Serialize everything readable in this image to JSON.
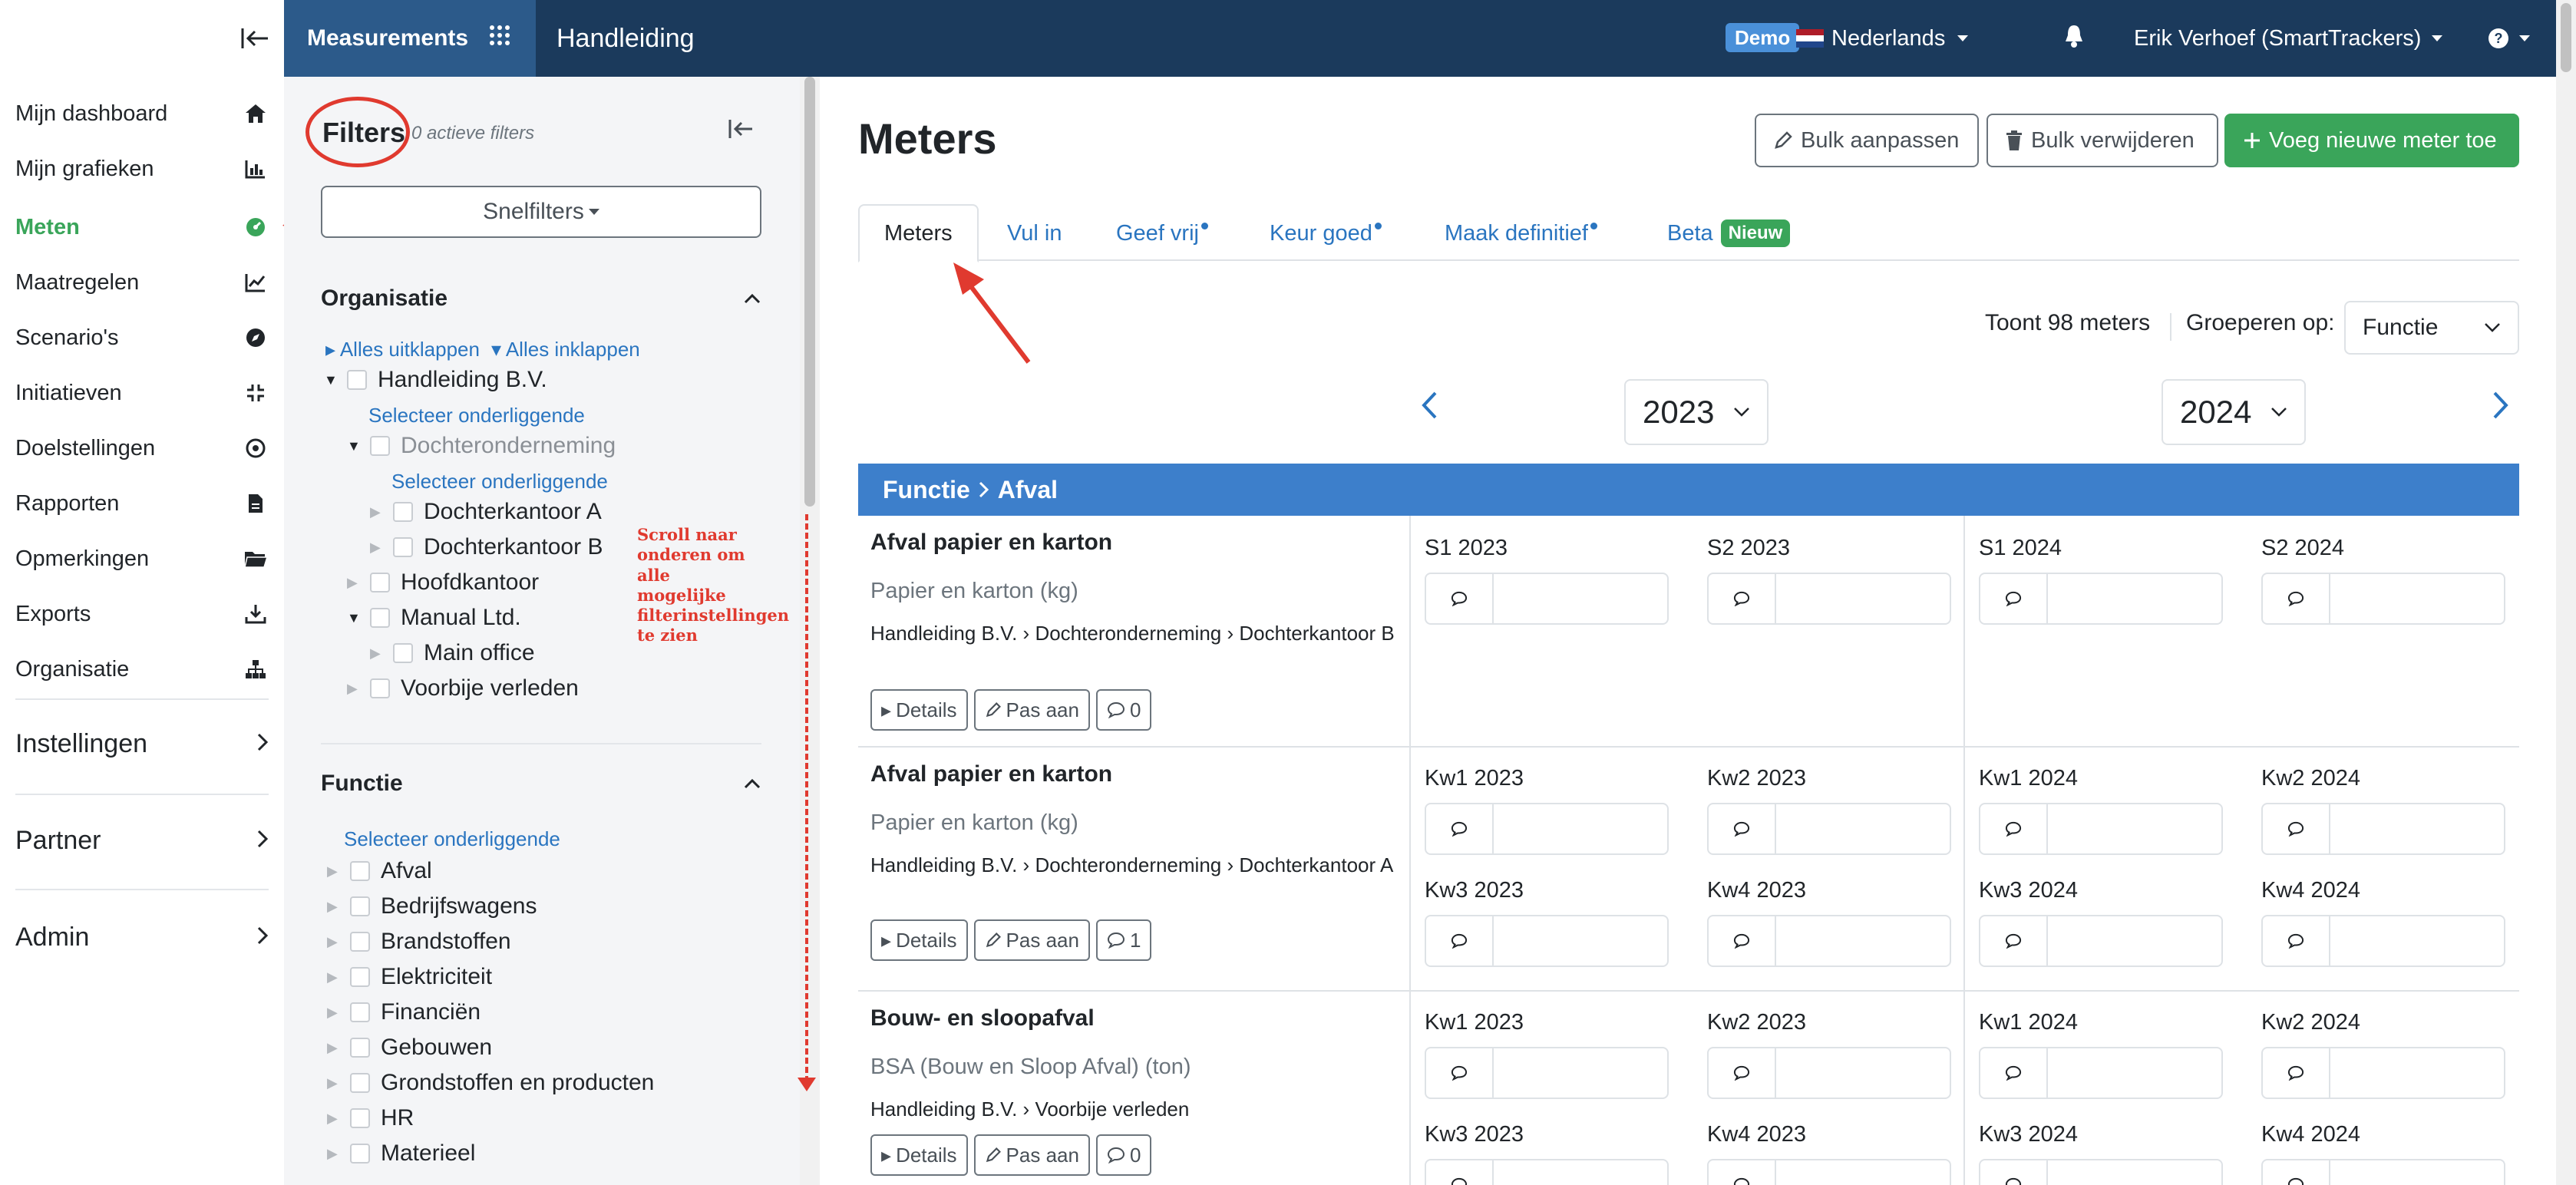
{
  "nav": {
    "items": [
      {
        "label": "Mijn dashboard",
        "icon": "home-icon"
      },
      {
        "label": "Mijn grafieken",
        "icon": "bar-chart-icon"
      },
      {
        "label": "Meten",
        "icon": "gauge-icon"
      },
      {
        "label": "Maatregelen",
        "icon": "line-chart-icon"
      },
      {
        "label": "Scenario's",
        "icon": "compass-icon"
      },
      {
        "label": "Initiatieven",
        "icon": "compress-icon"
      },
      {
        "label": "Doelstellingen",
        "icon": "target-icon"
      },
      {
        "label": "Rapporten",
        "icon": "file-icon"
      },
      {
        "label": "Opmerkingen",
        "icon": "folder-icon"
      },
      {
        "label": "Exports",
        "icon": "download-icon"
      },
      {
        "label": "Organisatie",
        "icon": "org-chart-icon"
      }
    ],
    "groups": [
      {
        "label": "Instellingen"
      },
      {
        "label": "Partner"
      },
      {
        "label": "Admin"
      }
    ]
  },
  "topbar": {
    "brand": "Measurements",
    "title": "Handleiding",
    "demo": "Demo",
    "language": "Nederlands",
    "user": "Erik Verhoef (SmartTrackers)",
    "help": "?"
  },
  "filters": {
    "title": "Filters",
    "active_count": "0 actieve filters",
    "quick": "Snelfilters",
    "org_header": "Organisatie",
    "expand_all": "Alles uitklappen",
    "collapse_all": "Alles inklappen",
    "select_children": "Selecteer onderliggende",
    "org_tree": [
      "Handleiding B.V.",
      "Dochteronderneming",
      "Dochterkantoor A",
      "Dochterkantoor B",
      "Hoofdkantoor",
      "Manual Ltd.",
      "Main office",
      "Voorbije verleden"
    ],
    "function_header": "Functie",
    "functions": [
      "Afval",
      "Bedrijfswagens",
      "Brandstoffen",
      "Elektriciteit",
      "Financiën",
      "Gebouwen",
      "Grondstoffen en producten",
      "HR",
      "Materieel"
    ],
    "annotation": "Scroll naar onderen om alle mogelijke filterinstellingen te zien"
  },
  "main": {
    "title": "Meters",
    "bulk_edit": "Bulk aanpassen",
    "bulk_delete": "Bulk verwijderen",
    "add_meter": "Voeg nieuwe meter toe",
    "tabs": [
      "Meters",
      "Vul in",
      "Geef vrij",
      "Keur goed",
      "Maak definitief",
      "Beta"
    ],
    "new_badge": "Nieuw",
    "count": "Toont 98 meters",
    "group_by_label": "Groeperen op:",
    "group_by_value": "Functie",
    "year_left": "2023",
    "year_right": "2024",
    "group_header_a": "Functie",
    "group_header_b": "Afval",
    "details": "Details",
    "edit": "Pas aan",
    "meters": [
      {
        "title": "Afval papier en karton",
        "unit": "Papier en karton (kg)",
        "path": [
          "Handleiding B.V.",
          "Dochteronderneming",
          "Dochterkantoor B"
        ],
        "comments": "0",
        "periods": [
          "S1 2023",
          "S2 2023",
          "S1 2024",
          "S2 2024"
        ]
      },
      {
        "title": "Afval papier en karton",
        "unit": "Papier en karton (kg)",
        "path": [
          "Handleiding B.V.",
          "Dochteronderneming",
          "Dochterkantoor A"
        ],
        "comments": "1",
        "periods": [
          "Kw1 2023",
          "Kw2 2023",
          "Kw1 2024",
          "Kw2 2024",
          "Kw3 2023",
          "Kw4 2023",
          "Kw3 2024",
          "Kw4 2024"
        ]
      },
      {
        "title": "Bouw- en sloopafval",
        "unit": "BSA (Bouw en Sloop Afval) (ton)",
        "path": [
          "Handleiding B.V.",
          "Voorbije verleden"
        ],
        "comments": "0",
        "periods": [
          "Kw1 2023",
          "Kw2 2023",
          "Kw1 2024",
          "Kw2 2024",
          "Kw3 2023",
          "Kw4 2023",
          "Kw3 2024",
          "Kw4 2024"
        ]
      }
    ]
  },
  "colors": {
    "brand_dark": "#1b3a5c",
    "brand_light": "#2c5a8a",
    "accent_green": "#3aa55a",
    "link_blue": "#2a75c0",
    "group_header": "#3d7fcb",
    "annotation_red": "#e03a2f"
  }
}
